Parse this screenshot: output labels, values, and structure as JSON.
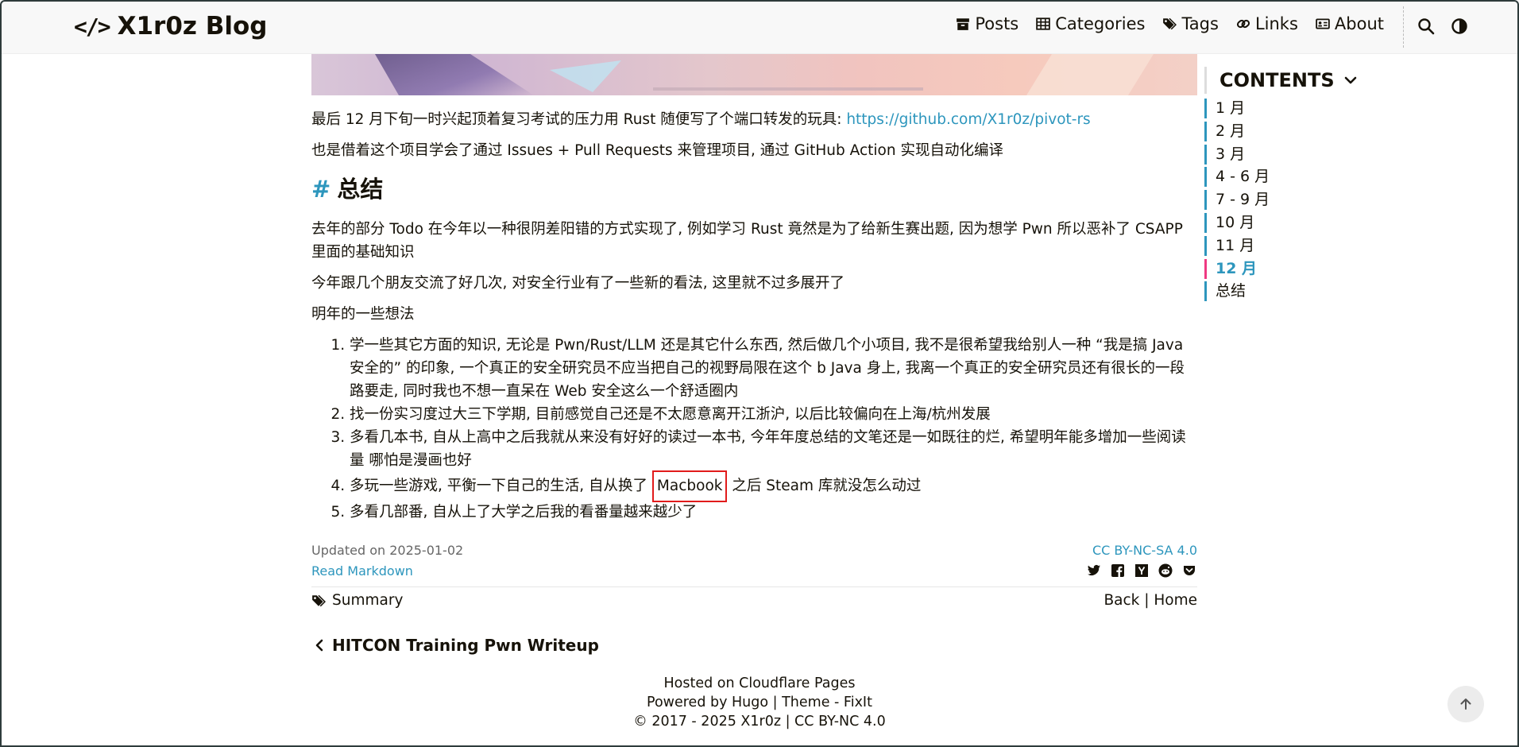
{
  "header": {
    "logo_text": "X1r0z Blog",
    "nav": [
      {
        "label": "Posts",
        "icon": "archive-icon"
      },
      {
        "label": "Categories",
        "icon": "grid-icon"
      },
      {
        "label": "Tags",
        "icon": "tags-icon"
      },
      {
        "label": "Links",
        "icon": "link-icon"
      },
      {
        "label": "About",
        "icon": "id-card-icon"
      }
    ]
  },
  "article": {
    "p1_text": "最后 12 月下旬一时兴起顶着复习考试的压力用 Rust 随便写了个端口转发的玩具: ",
    "p1_link": "https://github.com/X1r0z/pivot-rs",
    "p2": "也是借着这个项目学会了通过 Issues + Pull Requests 来管理项目, 通过 GitHub Action 实现自动化编译",
    "heading_hash": "#",
    "heading": "总结",
    "p3": "去年的部分 Todo 在今年以一种很阴差阳错的方式实现了, 例如学习 Rust 竟然是为了给新生赛出题, 因为想学 Pwn 所以恶补了 CSAPP 里面的基础知识",
    "p4": "今年跟几个朋友交流了好几次, 对安全行业有了一些新的看法, 这里就不过多展开了",
    "p5": "明年的一些想法",
    "list": [
      "学一些其它方面的知识, 无论是 Pwn/Rust/LLM 还是其它什么东西, 然后做几个小项目, 我不是很希望我给别人一种 “我是搞 Java 安全的” 的印象, 一个真正的安全研究员不应当把自己的视野局限在这个 b Java 身上, 我离一个真正的安全研究员还有很长的一段路要走, 同时我也不想一直呆在 Web 安全这么一个舒适圈内",
      "找一份实习度过大三下学期, 目前感觉自己还是不太愿意离开江浙沪, 以后比较偏向在上海/杭州发展",
      "多看几本书, 自从上高中之后我就从来没有好好的读过一本书, 今年年度总结的文笔还是一如既往的烂, 希望明年能多增加一些阅读量 哪怕是漫画也好"
    ],
    "item4_before": "多玩一些游戏, 平衡一下自己的生活, 自从换了 ",
    "item4_highlight": "Macbook",
    "item4_after": " 之后 Steam 库就没怎么动过",
    "item5": "多看几部番, 自从上了大学之后我的看番量越来越少了"
  },
  "post_footer": {
    "updated": "Updated on 2025-01-02",
    "license": "CC BY-NC-SA 4.0",
    "read_markdown": "Read Markdown",
    "tag": "Summary",
    "back": "Back",
    "separator": " | ",
    "home": "Home",
    "share_icons": [
      "twitter-icon",
      "facebook-icon",
      "hacker-news-icon",
      "reddit-icon",
      "pocket-icon"
    ]
  },
  "prev_post": "HITCON Training Pwn Writeup",
  "site_footer": {
    "line1": "Hosted on Cloudflare Pages",
    "line2": "Powered by Hugo | Theme - FixIt",
    "line3": "2017 - 2025 X1r0z | CC BY-NC 4.0",
    "copyright_symbol": "©"
  },
  "toc": {
    "title": "CONTENTS",
    "items": [
      "1 月",
      "2 月",
      "3 月",
      "4 - 6 月",
      "7 - 9 月",
      "10 月",
      "11 月",
      "12 月",
      "总结"
    ],
    "active": "12 月"
  },
  "colors": {
    "link": "#2d96bd",
    "toc_active_bar": "#ef3982",
    "highlight_box": "#e11b1b"
  }
}
